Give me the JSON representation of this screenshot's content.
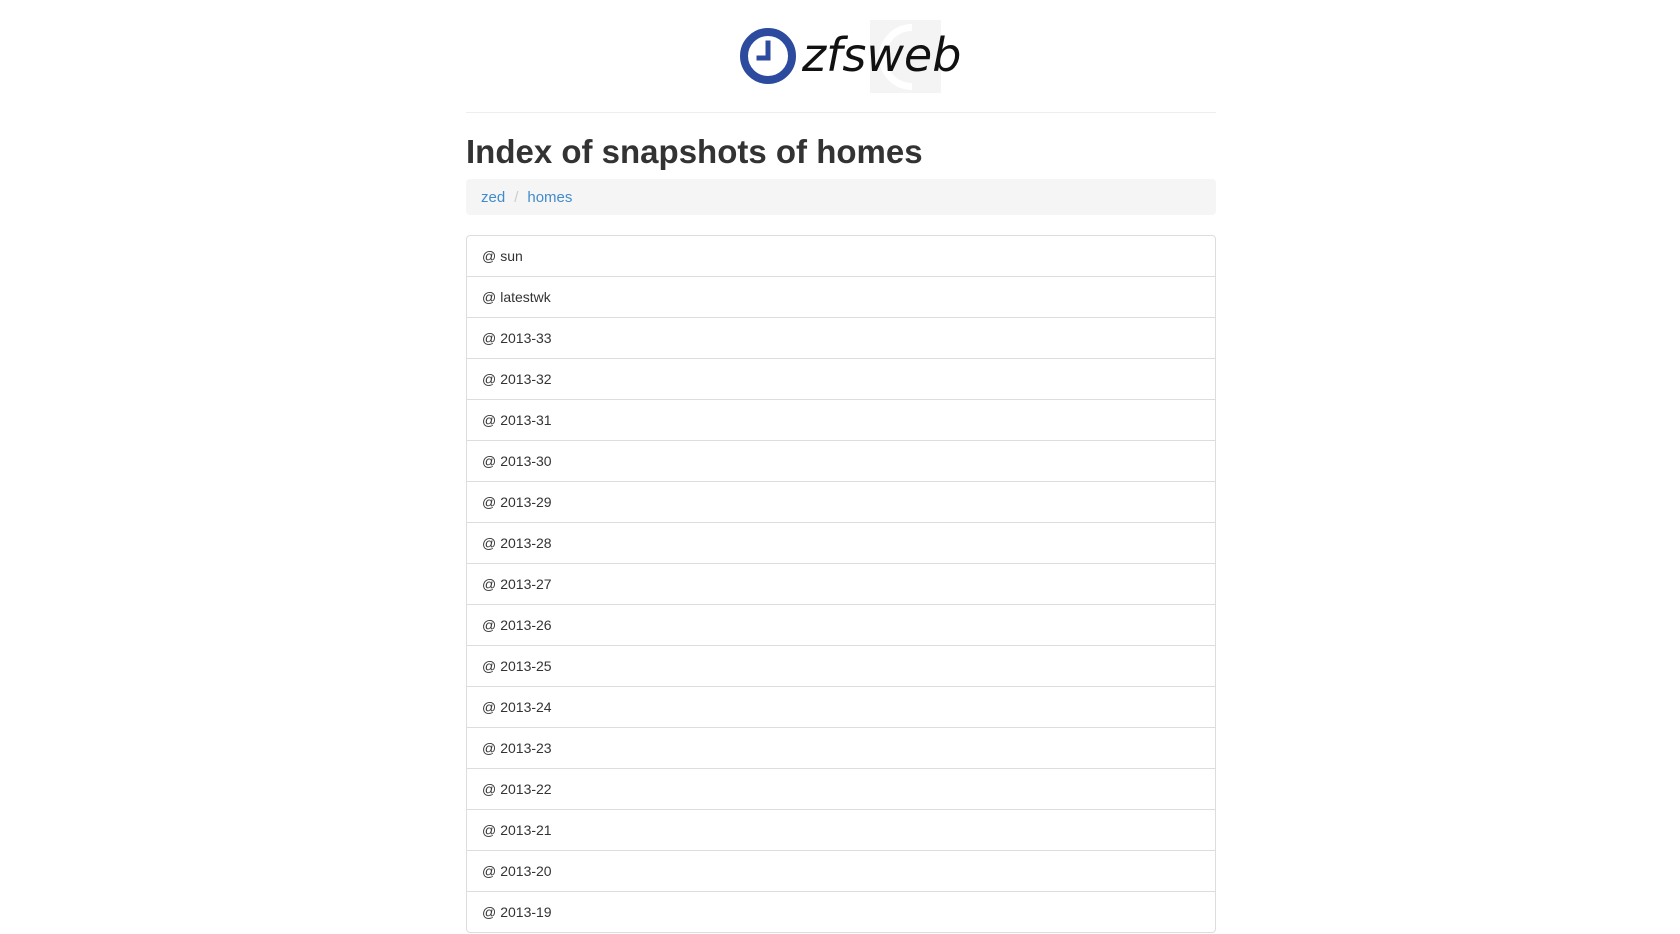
{
  "logo": {
    "text_thin": "zfs",
    "text_regular": "web",
    "brand_color": "#2c4a9e"
  },
  "page_title": "Index of snapshots of homes",
  "breadcrumb": {
    "items": [
      {
        "label": "zed"
      },
      {
        "label": "homes"
      }
    ],
    "separator": "/"
  },
  "snapshots": {
    "prefix": "@",
    "items": [
      "sun",
      "latestwk",
      "2013-33",
      "2013-32",
      "2013-31",
      "2013-30",
      "2013-29",
      "2013-28",
      "2013-27",
      "2013-26",
      "2013-25",
      "2013-24",
      "2013-23",
      "2013-22",
      "2013-21",
      "2013-20",
      "2013-19"
    ]
  }
}
